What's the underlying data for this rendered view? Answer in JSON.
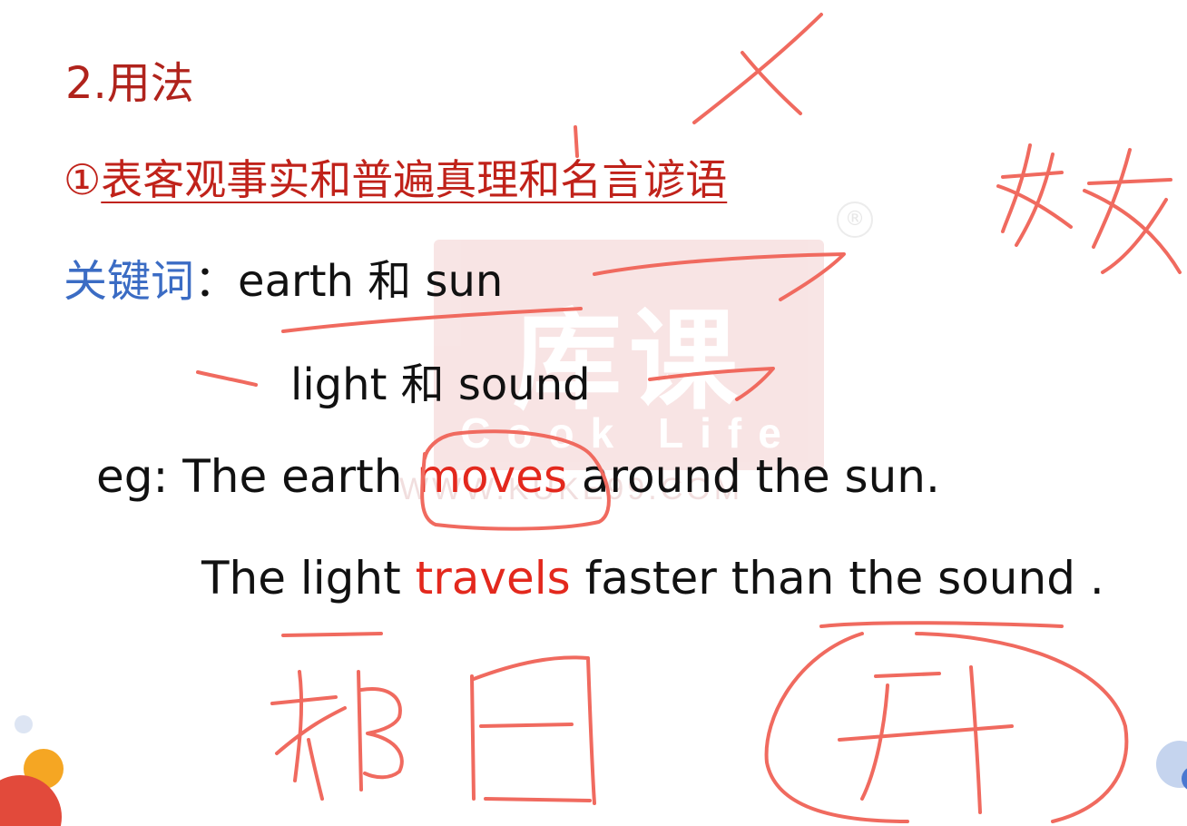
{
  "watermark": {
    "logo": "库课",
    "tagline": "Cook Life",
    "url": "WWW.KUKE99.COM",
    "registered": "®"
  },
  "slide": {
    "section_title": "2.用法",
    "heading": {
      "number": "①",
      "text": "表客观事实和普遍真理和名言谚语"
    },
    "keywords": {
      "label": "关键词",
      "colon": "：",
      "line1": "earth 和 sun",
      "line2": "light 和 sound"
    },
    "examples": {
      "prefix": "eg: ",
      "ex1": {
        "before": "The earth ",
        "verb": "moves",
        "after": " around the sun."
      },
      "ex2": {
        "before": "The light ",
        "verb": "travels",
        "after": " faster than the sound ."
      }
    }
  },
  "colors": {
    "title": "#b0231c",
    "heading": "#c0221a",
    "keyword_label": "#3b6cc4",
    "verb_highlight": "#e3281d",
    "ink": "#f06a5f"
  }
}
